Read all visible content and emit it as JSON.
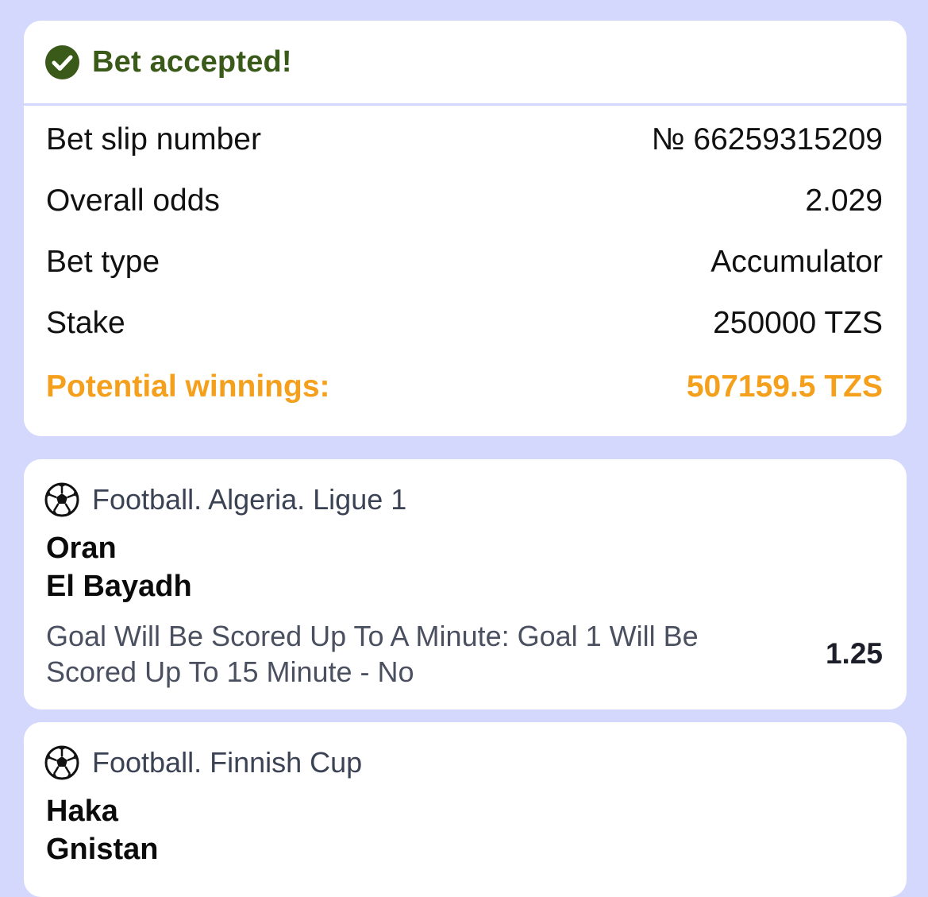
{
  "colors": {
    "background": "#d4d8fd",
    "card": "#ffffff",
    "accepted_green": "#3a5a1a",
    "winnings_orange": "#f5a01c"
  },
  "summary": {
    "title": "Bet accepted!",
    "icon": "check-circle-icon",
    "rows": [
      {
        "label": "Bet slip number",
        "value": "№ 66259315209"
      },
      {
        "label": "Overall odds",
        "value": "2.029"
      },
      {
        "label": "Bet type",
        "value": "Accumulator"
      },
      {
        "label": "Stake",
        "value": "250000 TZS"
      }
    ],
    "potential": {
      "label": "Potential winnings:",
      "value": "507159.5 TZS"
    }
  },
  "events": [
    {
      "icon": "football-icon",
      "league": "Football. Algeria. Ligue 1",
      "team1": "Oran",
      "team2": "El Bayadh",
      "market": "Goal Will Be Scored Up To A Minute: Goal 1 Will Be Scored Up To 15 Minute - No",
      "odds": "1.25"
    },
    {
      "icon": "football-icon",
      "league": "Football. Finnish Cup",
      "team1": "Haka",
      "team2": "Gnistan"
    }
  ]
}
